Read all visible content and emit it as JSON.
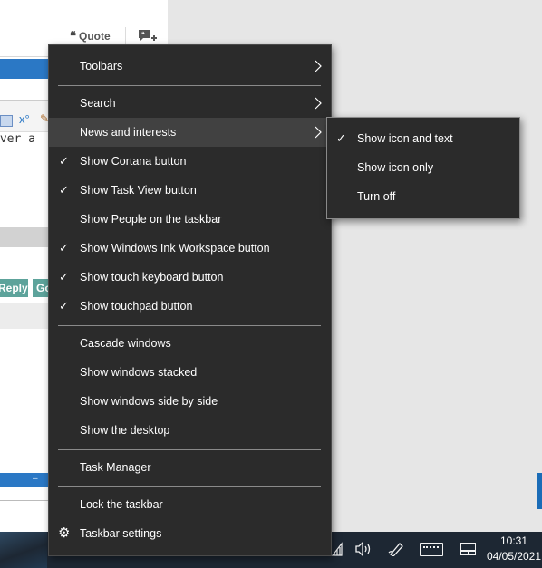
{
  "background_page": {
    "quote_label": "Quote",
    "editor_text": "over a",
    "toolbar_x": "x°",
    "reply_label": "Reply",
    "go_label": "Go",
    "strip_text": "–"
  },
  "context_menu": {
    "items": [
      {
        "label": "Toolbars",
        "checked": false,
        "submenu": true
      },
      {
        "label": "Search",
        "checked": false,
        "submenu": true
      },
      {
        "label": "News and interests",
        "checked": false,
        "submenu": true,
        "highlighted": true
      },
      {
        "label": "Show Cortana button",
        "checked": true
      },
      {
        "label": "Show Task View button",
        "checked": true
      },
      {
        "label": "Show People on the taskbar",
        "checked": false
      },
      {
        "label": "Show Windows Ink Workspace button",
        "checked": true
      },
      {
        "label": "Show touch keyboard button",
        "checked": true
      },
      {
        "label": "Show touchpad button",
        "checked": true
      },
      {
        "label": "Cascade windows",
        "checked": false
      },
      {
        "label": "Show windows stacked",
        "checked": false
      },
      {
        "label": "Show windows side by side",
        "checked": false
      },
      {
        "label": "Show the desktop",
        "checked": false
      },
      {
        "label": "Task Manager",
        "checked": false
      },
      {
        "label": "Lock the taskbar",
        "checked": false
      },
      {
        "label": "Taskbar settings",
        "checked": false,
        "icon": "gear-icon"
      }
    ],
    "check_glyph": "✓",
    "highlight_color": "#414141"
  },
  "submenu": {
    "items": [
      {
        "label": "Show icon and text",
        "checked": true
      },
      {
        "label": "Show icon only",
        "checked": false
      },
      {
        "label": "Turn off",
        "checked": false
      }
    ]
  },
  "taskbar": {
    "time": "10:31",
    "date": "04/05/2021",
    "tray_icons": [
      "wifi-icon",
      "volume-icon",
      "pen-icon",
      "keyboard-icon",
      "touchpad-icon"
    ]
  }
}
